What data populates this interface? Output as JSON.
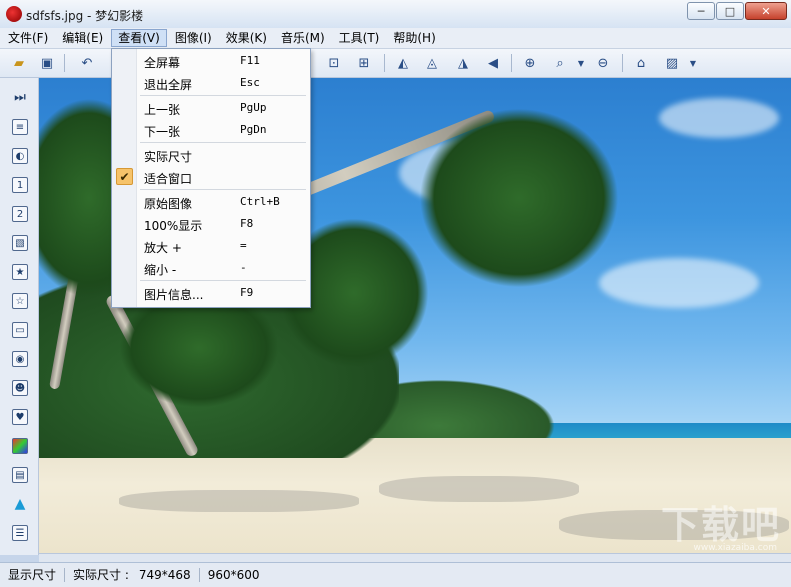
{
  "window": {
    "title": "sdfsfs.jpg - 梦幻影楼",
    "minimize": "─",
    "maximize": "□",
    "close": "✕"
  },
  "menubar": {
    "items": [
      {
        "label": "文件(F)"
      },
      {
        "label": "编辑(E)"
      },
      {
        "label": "查看(V)"
      },
      {
        "label": "图像(I)"
      },
      {
        "label": "效果(K)"
      },
      {
        "label": "音乐(M)"
      },
      {
        "label": "工具(T)"
      },
      {
        "label": "帮助(H)"
      }
    ],
    "active_index": 2
  },
  "toolbar": {
    "icons": [
      "open-folder-icon",
      "save-icon",
      "undo-icon",
      "fit-window-icon",
      "fullscreen-icon",
      "flip-left-icon",
      "flip-up-icon",
      "mirror-icon",
      "rotate-icon",
      "zoom-in-icon",
      "zoom-icon",
      "zoom-out-icon",
      "home-icon",
      "image-icon"
    ]
  },
  "sidebar": {
    "icons": [
      "play-next-icon",
      "frame-icon",
      "contrast-icon",
      "page-one-icon",
      "page-two-icon",
      "picture-icon",
      "slideshow-a-icon",
      "slideshow-b-icon",
      "layer-icon",
      "camera-icon",
      "portrait-icon",
      "heart-icon",
      "color-icon",
      "film-icon",
      "triangle-icon",
      "list-icon"
    ]
  },
  "view_menu": {
    "items": [
      {
        "label": "全屏幕",
        "shortcut": "F11"
      },
      {
        "label": "退出全屏",
        "shortcut": "Esc"
      },
      {
        "label": "上一张",
        "shortcut": "PgUp"
      },
      {
        "label": "下一张",
        "shortcut": "PgDn"
      },
      {
        "label": "实际尺寸",
        "shortcut": ""
      },
      {
        "label": "适合窗口",
        "shortcut": "",
        "checked": true
      },
      {
        "label": "原始图像",
        "shortcut": "Ctrl+B"
      },
      {
        "label": "100%显示",
        "shortcut": "F8"
      },
      {
        "label": "放大 +",
        "shortcut": "="
      },
      {
        "label": "缩小 -",
        "shortcut": "-"
      },
      {
        "label": "图片信息...",
        "shortcut": "F9"
      }
    ],
    "check_glyph": "✔"
  },
  "statusbar": {
    "display_size": "显示尺寸",
    "actual_size_label": "实际尺寸 :",
    "display_dims": "749*468",
    "actual_dims": "960*600"
  },
  "watermark": {
    "text": "下载吧",
    "sub": "www.xiazaiba.com"
  },
  "colors": {
    "accent": "#cfe0f6",
    "check": "#f6c36a"
  }
}
